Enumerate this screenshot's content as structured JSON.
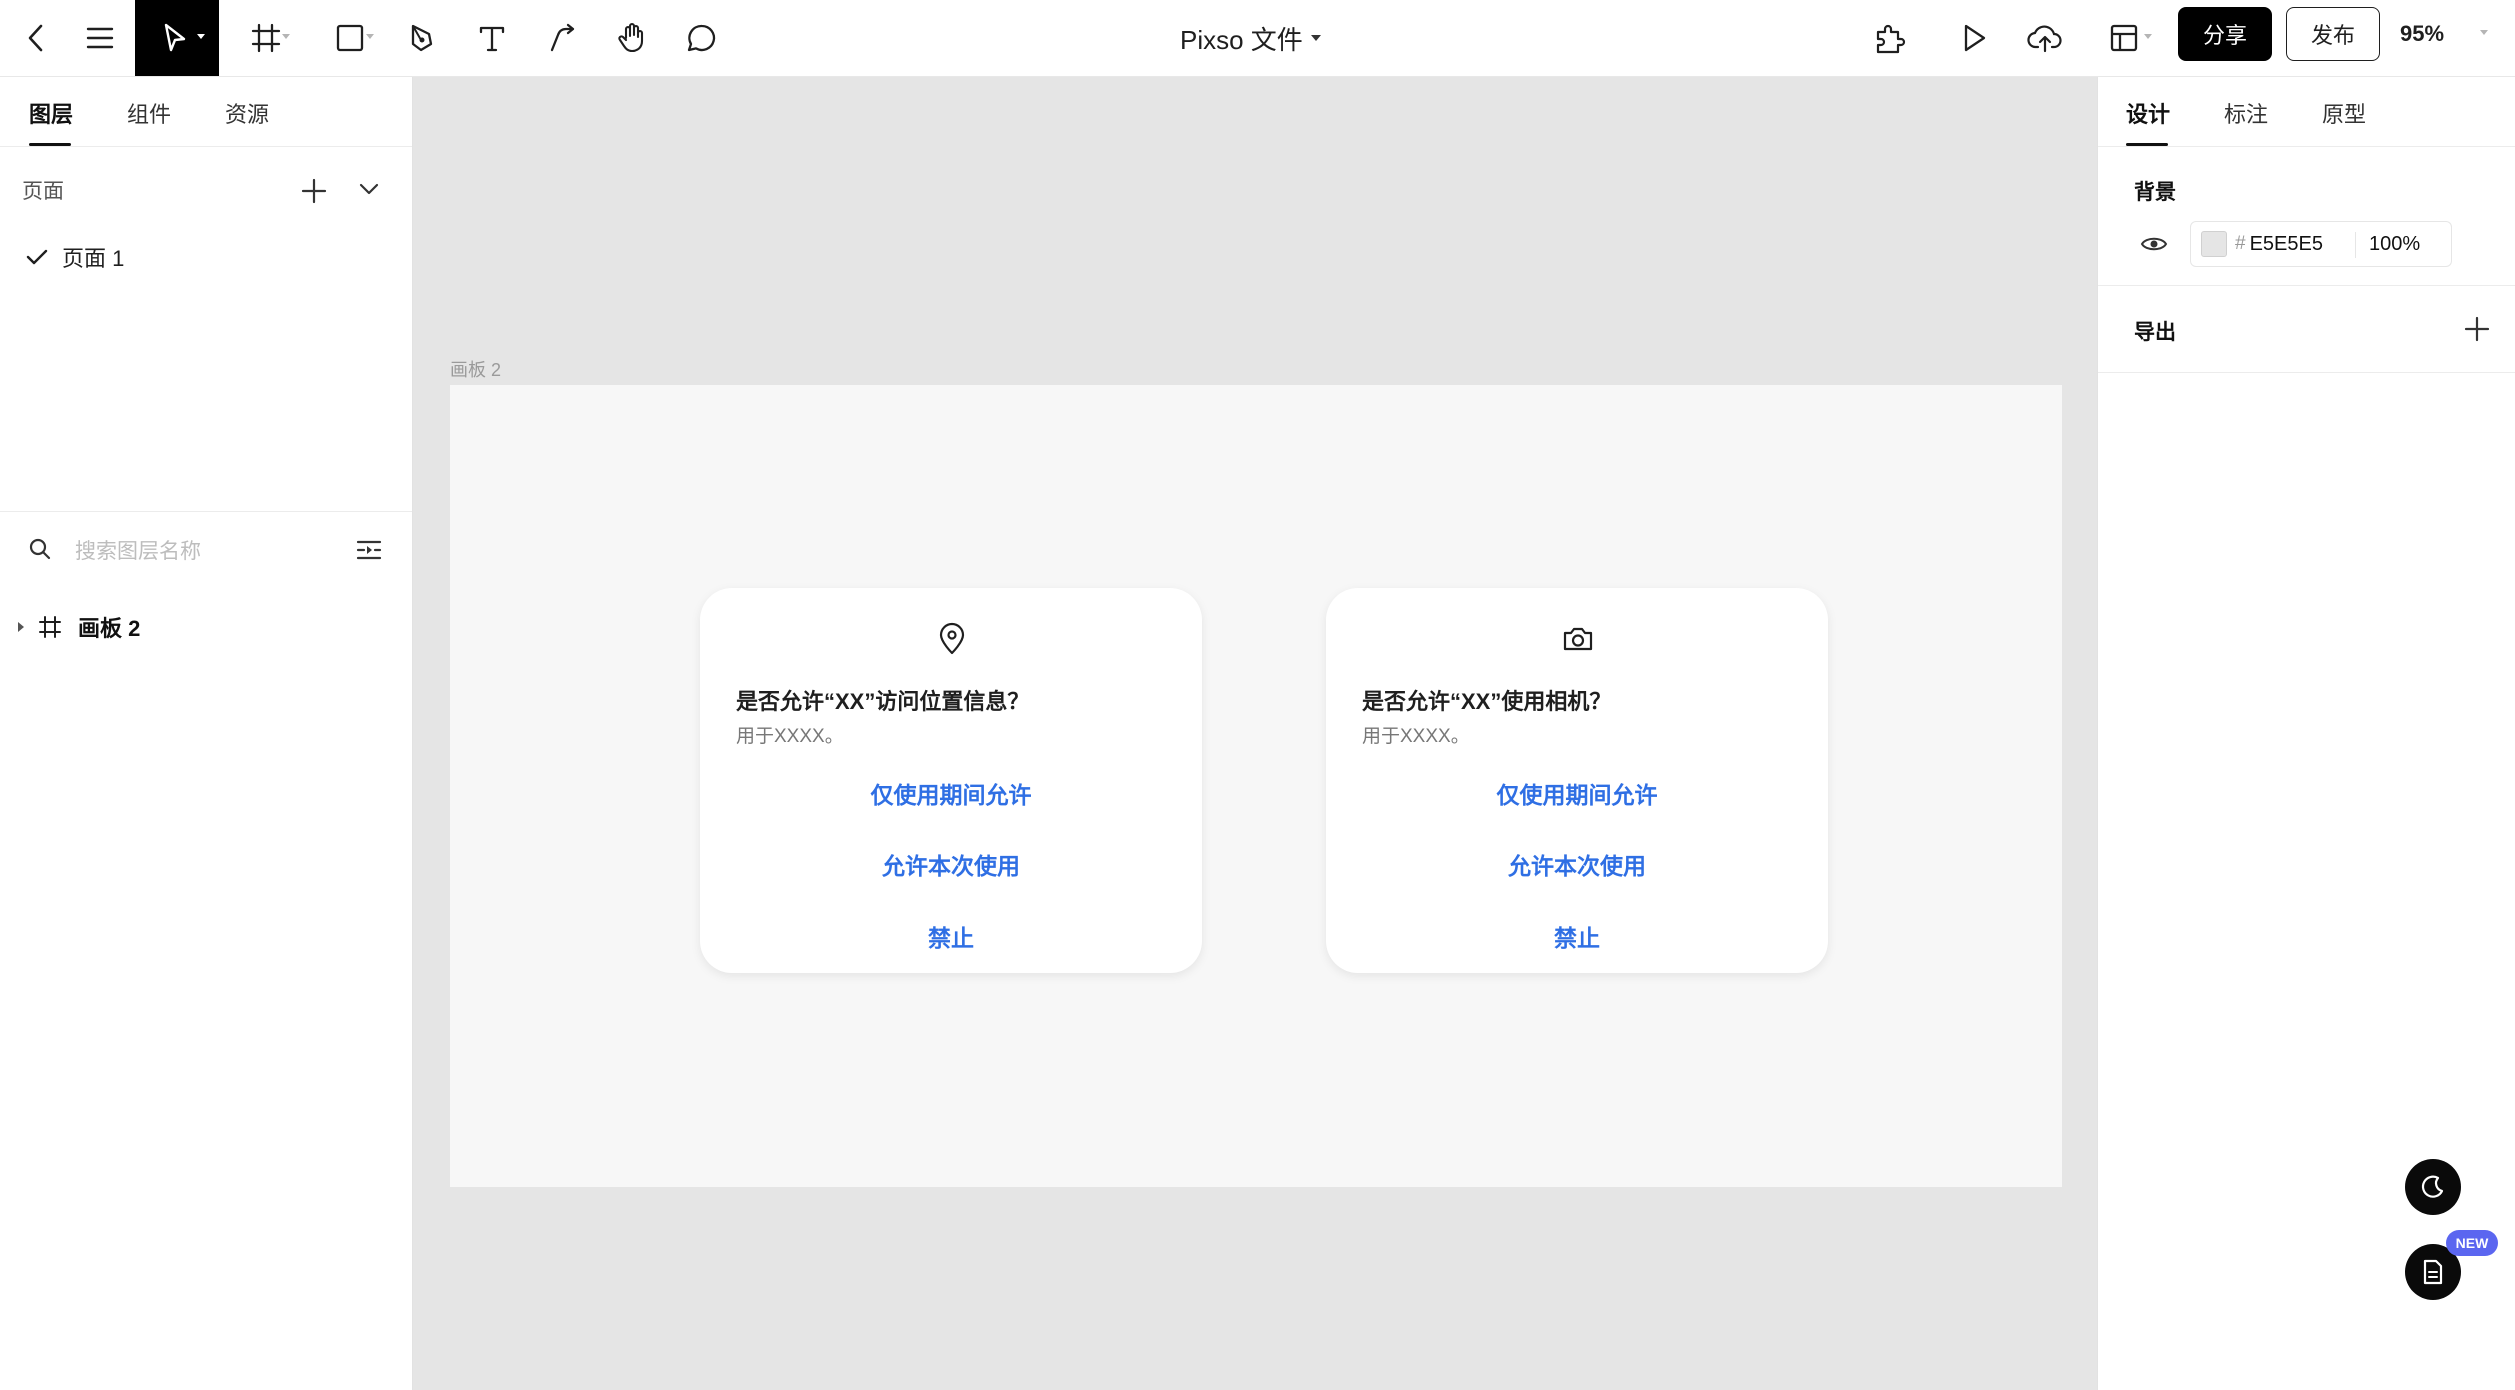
{
  "toolbar": {
    "doc_title": "Pixso 文件",
    "share_label": "分享",
    "publish_label": "发布",
    "zoom": "95%"
  },
  "left_panel": {
    "tabs": [
      "图层",
      "组件",
      "资源"
    ],
    "pages_label": "页面",
    "pages": [
      "页面 1"
    ],
    "search_placeholder": "搜索图层名称",
    "layers": [
      "画板 2"
    ]
  },
  "right_panel": {
    "tabs": [
      "设计",
      "标注",
      "原型"
    ],
    "background_label": "背景",
    "background_color": "E5E5E5",
    "background_opacity": "100%",
    "export_label": "导出"
  },
  "canvas": {
    "artboard_label": "画板 2",
    "dialogs": [
      {
        "icon": "location-pin-icon",
        "title": "是否允许“XX”访问位置信息？",
        "subtitle": "用于XXXX。",
        "actions": [
          "仅使用期间允许",
          "允许本次使用",
          "禁止"
        ]
      },
      {
        "icon": "camera-icon",
        "title": "是否允许“XX”使用相机？",
        "subtitle": "用于XXXX。",
        "actions": [
          "仅使用期间允许",
          "允许本次使用",
          "禁止"
        ]
      }
    ]
  },
  "floating": {
    "badge": "NEW"
  },
  "colors": {
    "accent": "#2f6fe4",
    "canvas_bg": "#e5e5e5",
    "artboard_bg": "#f7f7f7",
    "badge": "#5b66f0"
  }
}
